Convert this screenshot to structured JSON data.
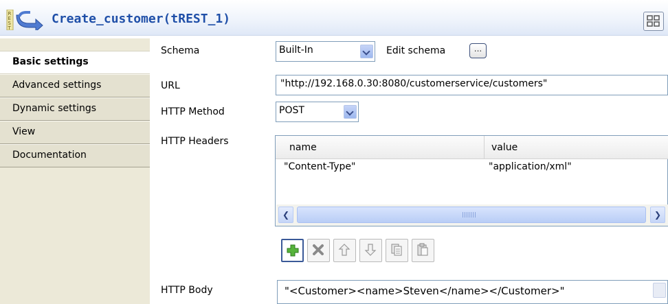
{
  "title": "Create_customer(tREST_1)",
  "colors": {
    "title": "#1f4fa8",
    "accent": "#7f9db9"
  },
  "sidebar": {
    "tabs": [
      {
        "label": "Basic settings",
        "active": true
      },
      {
        "label": "Advanced settings",
        "active": false
      },
      {
        "label": "Dynamic settings",
        "active": false
      },
      {
        "label": "View",
        "active": false
      },
      {
        "label": "Documentation",
        "active": false
      }
    ]
  },
  "form": {
    "schema_label": "Schema",
    "schema_value": "Built-In",
    "edit_schema_label": "Edit schema",
    "edit_schema_button": "...",
    "url_label": "URL",
    "url_value": "\"http://192.168.0.30:8080/customerservice/customers\"",
    "method_label": "HTTP Method",
    "method_value": "POST",
    "headers_label": "HTTP Headers",
    "headers": {
      "columns": [
        "name",
        "value"
      ],
      "rows": [
        {
          "name": "\"Content-Type\"",
          "value": "\"application/xml\""
        }
      ]
    },
    "body_label": "HTTP Body",
    "body_value": "\"<Customer><name>Steven</name></Customer>\""
  },
  "toolbar": {
    "icons": [
      "add-icon",
      "remove-icon",
      "move-up-icon",
      "move-down-icon",
      "copy-icon",
      "paste-icon"
    ]
  }
}
